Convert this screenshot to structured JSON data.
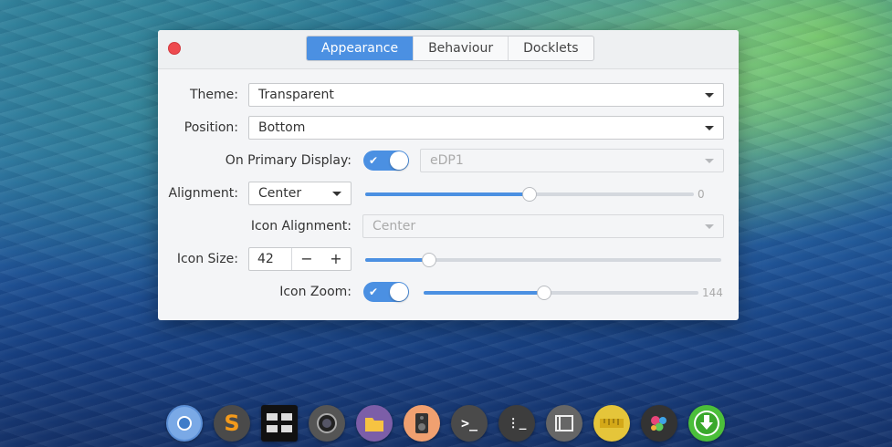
{
  "window": {
    "tabs": [
      "Appearance",
      "Behaviour",
      "Docklets"
    ]
  },
  "settings": {
    "theme": {
      "label": "Theme:",
      "value": "Transparent"
    },
    "position": {
      "label": "Position:",
      "value": "Bottom"
    },
    "primary_display": {
      "label": "On Primary Display:",
      "enabled": true,
      "value": "eDP1"
    },
    "alignment": {
      "label": "Alignment:",
      "value": "Center",
      "offset_value": "0",
      "offset_fraction": 0.5
    },
    "icon_alignment": {
      "label": "Icon Alignment:",
      "value": "Center"
    },
    "icon_size": {
      "label": "Icon Size:",
      "value": "42",
      "minus": "−",
      "plus": "+",
      "slider_fraction": 0.18
    },
    "icon_zoom": {
      "label": "Icon Zoom:",
      "enabled": true,
      "value": "144",
      "slider_fraction": 0.44
    }
  },
  "dock": {
    "icons": [
      "chromium-icon",
      "sublime-text-icon",
      "workspace-switcher-icon",
      "camera-icon",
      "files-icon",
      "speaker-icon",
      "terminal-icon",
      "terminal-alt-icon",
      "window-icon",
      "ruler-icon",
      "settings-gears-icon",
      "download-icon"
    ]
  },
  "colors": {
    "accent": "#4b90e2",
    "close": "#ee4a4f"
  }
}
